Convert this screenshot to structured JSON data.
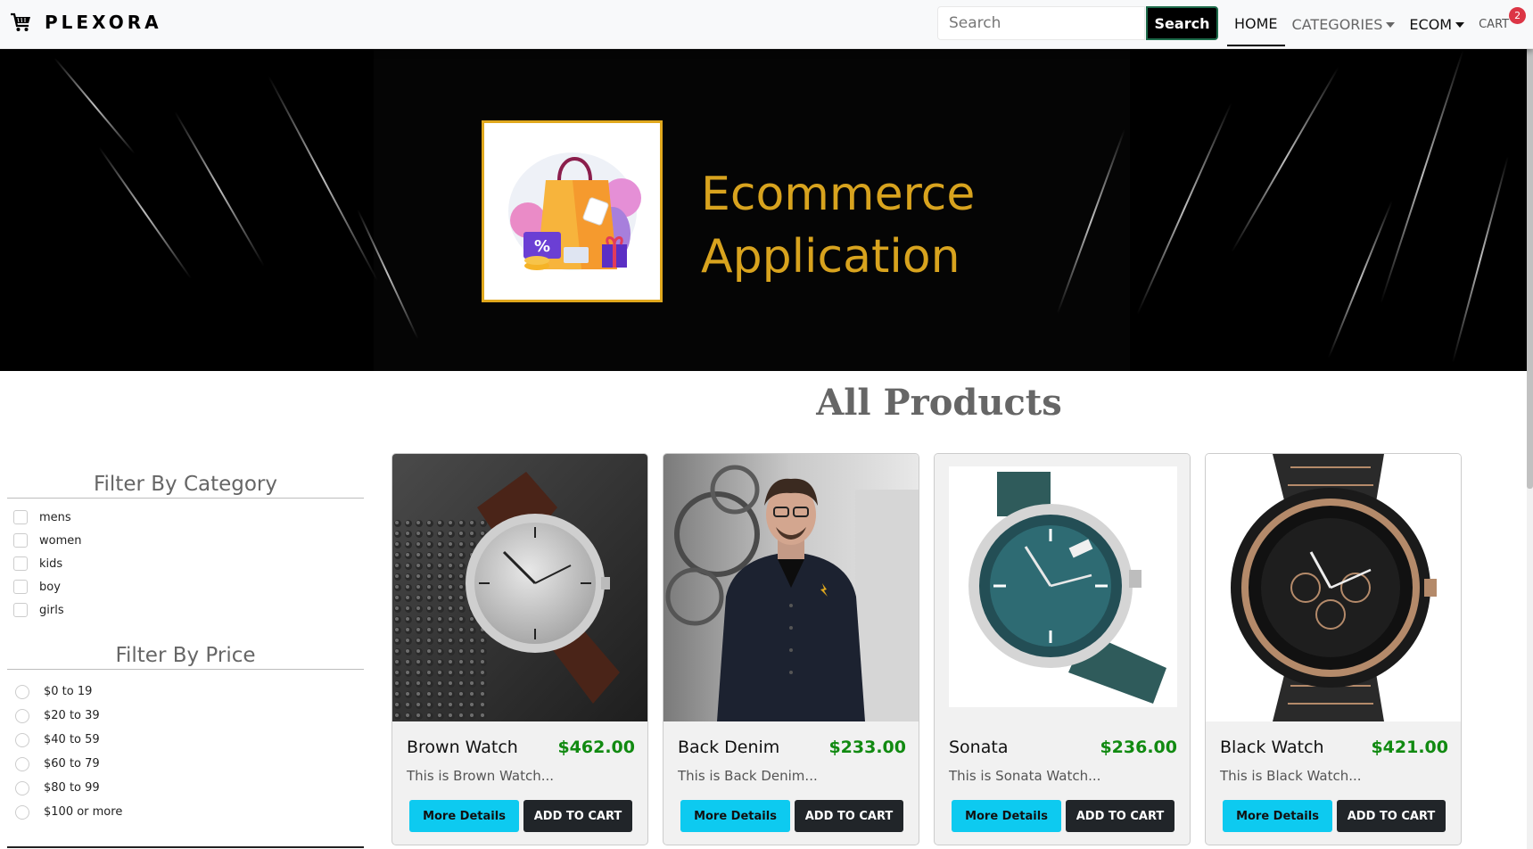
{
  "navbar": {
    "brand": "PLEXORA",
    "brand_icon": "cart-icon",
    "search_placeholder": "Search",
    "search_button": "Search",
    "links": {
      "home": "HOME",
      "categories": "CATEGORIES",
      "ecom": "ECOM",
      "cart": "CART"
    },
    "cart_count": "2"
  },
  "hero": {
    "title_line1": "Ecommerce",
    "title_line2": "Application",
    "logo": "shopping-bag-logo"
  },
  "products_heading": "All Products",
  "filters": {
    "category_title": "Filter By Category",
    "categories": [
      "mens",
      "women",
      "kids",
      "boy",
      "girls"
    ],
    "price_title": "Filter By Price",
    "prices": [
      "$0 to 19",
      "$20 to 39",
      "$40 to 59",
      "$60 to 79",
      "$80 to 99",
      "$100 or more"
    ]
  },
  "products": [
    {
      "name": "Brown Watch",
      "price": "$462.00",
      "description": "This is Brown Watch...",
      "details_label": "More Details",
      "cart_label": "ADD TO CART"
    },
    {
      "name": "Back Denim",
      "price": "$233.00",
      "description": "This is Back Denim...",
      "details_label": "More Details",
      "cart_label": "ADD TO CART"
    },
    {
      "name": "Sonata",
      "price": "$236.00",
      "description": "This is Sonata Watch...",
      "details_label": "More Details",
      "cart_label": "ADD TO CART"
    },
    {
      "name": "Black Watch",
      "price": "$421.00",
      "description": "This is Black Watch...",
      "details_label": "More Details",
      "cart_label": "ADD TO CART"
    }
  ],
  "colors": {
    "accent": "#0dcaf0",
    "price": "#118a11",
    "dark_button": "#212529",
    "hero_title": "#d8a31e",
    "badge": "#dc3545"
  }
}
